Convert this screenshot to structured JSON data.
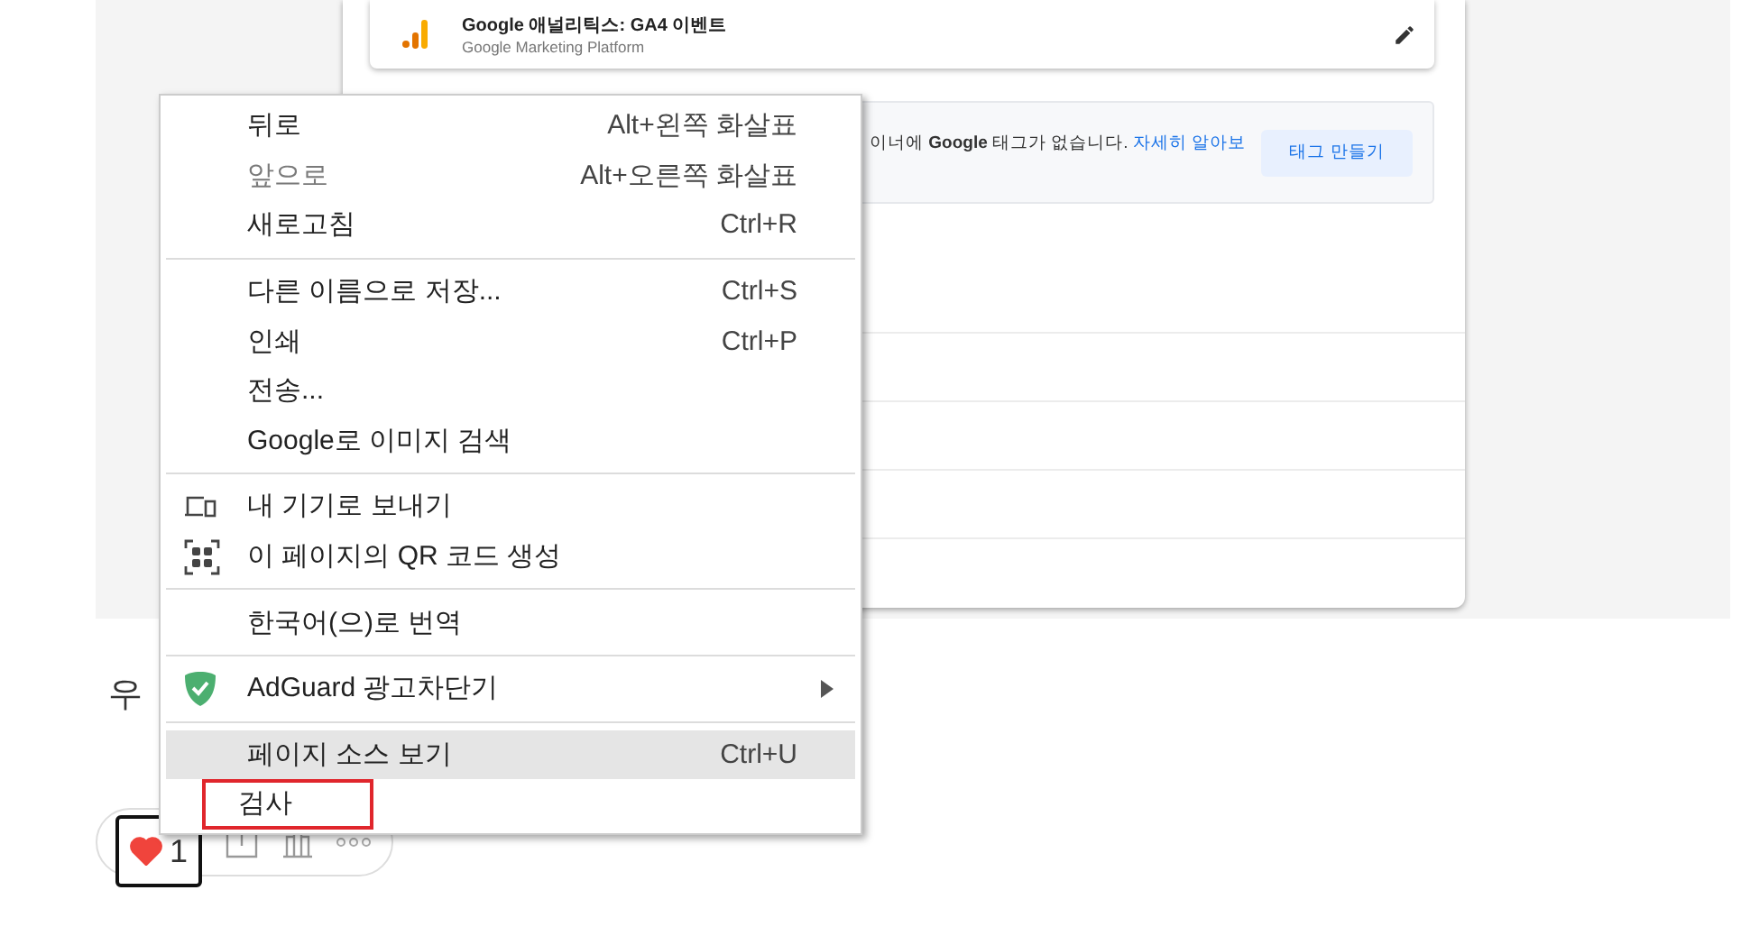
{
  "integration_card": {
    "title": "Google 애널리틱스: GA4 이벤트",
    "subtitle": "Google Marketing Platform"
  },
  "notice": {
    "text": "이너에 **Google** 태그가 없습니다.",
    "link": "자세히 알아보",
    "button": "태그 만들기"
  },
  "body_text": "우",
  "reactions": {
    "like_count": "1",
    "liked": true
  },
  "context_menu": {
    "sections": [
      {
        "items": [
          {
            "kind": "plain",
            "label": "뒤로",
            "shortcut": "Alt+왼쪽 화살표",
            "disabled": false,
            "selected": false,
            "outlined": false
          },
          {
            "kind": "plain",
            "label": "앞으로",
            "shortcut": "Alt+오른쪽 화살표",
            "disabled": true,
            "selected": false,
            "outlined": false
          },
          {
            "kind": "plain",
            "label": "새로고침",
            "shortcut": "Ctrl+R",
            "disabled": false,
            "selected": false,
            "outlined": false
          }
        ]
      },
      {
        "items": [
          {
            "kind": "plain",
            "label": "다른 이름으로 저장...",
            "shortcut": "Ctrl+S",
            "disabled": false,
            "selected": false,
            "outlined": false
          },
          {
            "kind": "plain",
            "label": "인쇄",
            "shortcut": "Ctrl+P",
            "disabled": false,
            "selected": false,
            "outlined": false
          },
          {
            "kind": "plain",
            "label": "전송...",
            "disabled": false,
            "selected": false,
            "outlined": false
          },
          {
            "kind": "plain",
            "label": "Google로 이미지 검색",
            "disabled": false,
            "selected": false,
            "outlined": false
          }
        ]
      },
      {
        "items": [
          {
            "kind": "device",
            "label": "내 기기로 보내기",
            "disabled": false,
            "selected": false,
            "outlined": false
          },
          {
            "kind": "qr",
            "label": "이 페이지의 QR 코드 생성",
            "disabled": false,
            "selected": false,
            "outlined": false
          }
        ]
      },
      {
        "items": [
          {
            "kind": "plain",
            "label": "한국어(으)로 번역",
            "disabled": false,
            "selected": false,
            "outlined": false
          }
        ]
      },
      {
        "items": [
          {
            "kind": "extension",
            "label": "AdGuard 광고차단기",
            "submenu": true,
            "disabled": false,
            "selected": false,
            "outlined": false
          }
        ]
      },
      {
        "items": [
          {
            "kind": "plain",
            "label": "페이지 소스 보기",
            "shortcut": "Ctrl+U",
            "disabled": false,
            "selected": true,
            "outlined": false
          },
          {
            "kind": "plain",
            "label": "검사",
            "disabled": false,
            "selected": false,
            "outlined": true
          }
        ]
      }
    ]
  }
}
